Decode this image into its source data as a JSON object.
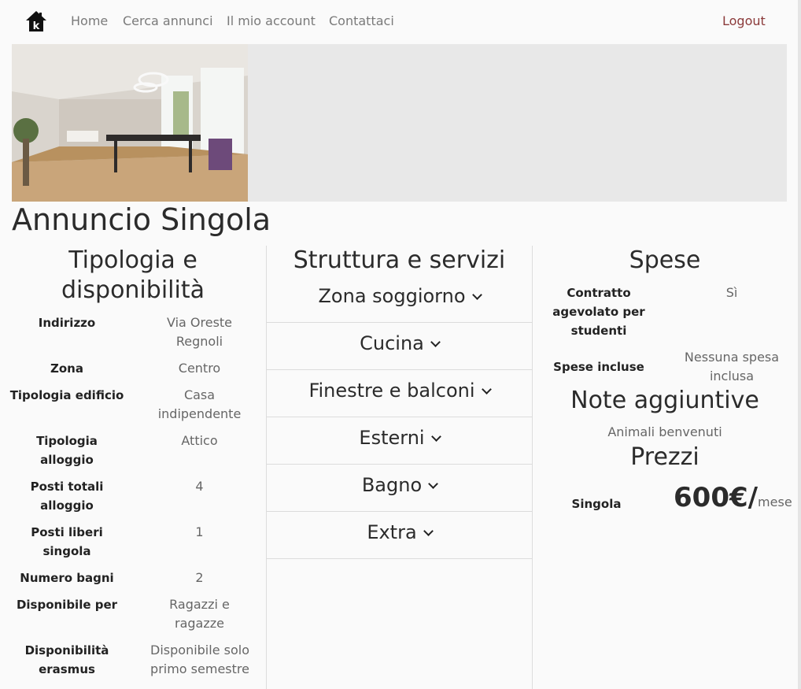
{
  "nav": {
    "links": [
      "Home",
      "Cerca annunci",
      "Il mio account",
      "Contattaci"
    ],
    "logout": "Logout"
  },
  "page_title": "Annuncio Singola",
  "left": {
    "title_line1": "Tipologia e",
    "title_line2": "disponibilità",
    "rows": [
      {
        "label": "Indirizzo",
        "value": "Via Oreste Regnoli"
      },
      {
        "label": "Zona",
        "value": "Centro"
      },
      {
        "label": "Tipologia edificio",
        "value": "Casa indipendente"
      },
      {
        "label": "Tipologia alloggio",
        "value": "Attico"
      },
      {
        "label": "Posti totali alloggio",
        "value": "4"
      },
      {
        "label": "Posti liberi singola",
        "value": "1"
      },
      {
        "label": "Numero bagni",
        "value": "2"
      },
      {
        "label": "Disponibile per",
        "value": "Ragazzi e ragazze"
      },
      {
        "label": "Disponibilità erasmus",
        "value": "Disponibile solo primo semestre"
      }
    ]
  },
  "middle": {
    "title": "Struttura e servizi",
    "sections": [
      "Zona soggiorno",
      "Cucina",
      "Finestre e balconi",
      "Esterni",
      "Bagno",
      "Extra"
    ]
  },
  "right": {
    "spese_title": "Spese",
    "spese": [
      {
        "label": "Contratto agevolato per studenti",
        "value": "Sì"
      },
      {
        "label": "Spese incluse",
        "value": "Nessuna spesa inclusa"
      }
    ],
    "note_title": "Note aggiuntive",
    "note": "Animali benvenuti",
    "prezzi_title": "Prezzi",
    "price_label": "Singola",
    "price_value": "600€/",
    "price_unit": "mese"
  }
}
